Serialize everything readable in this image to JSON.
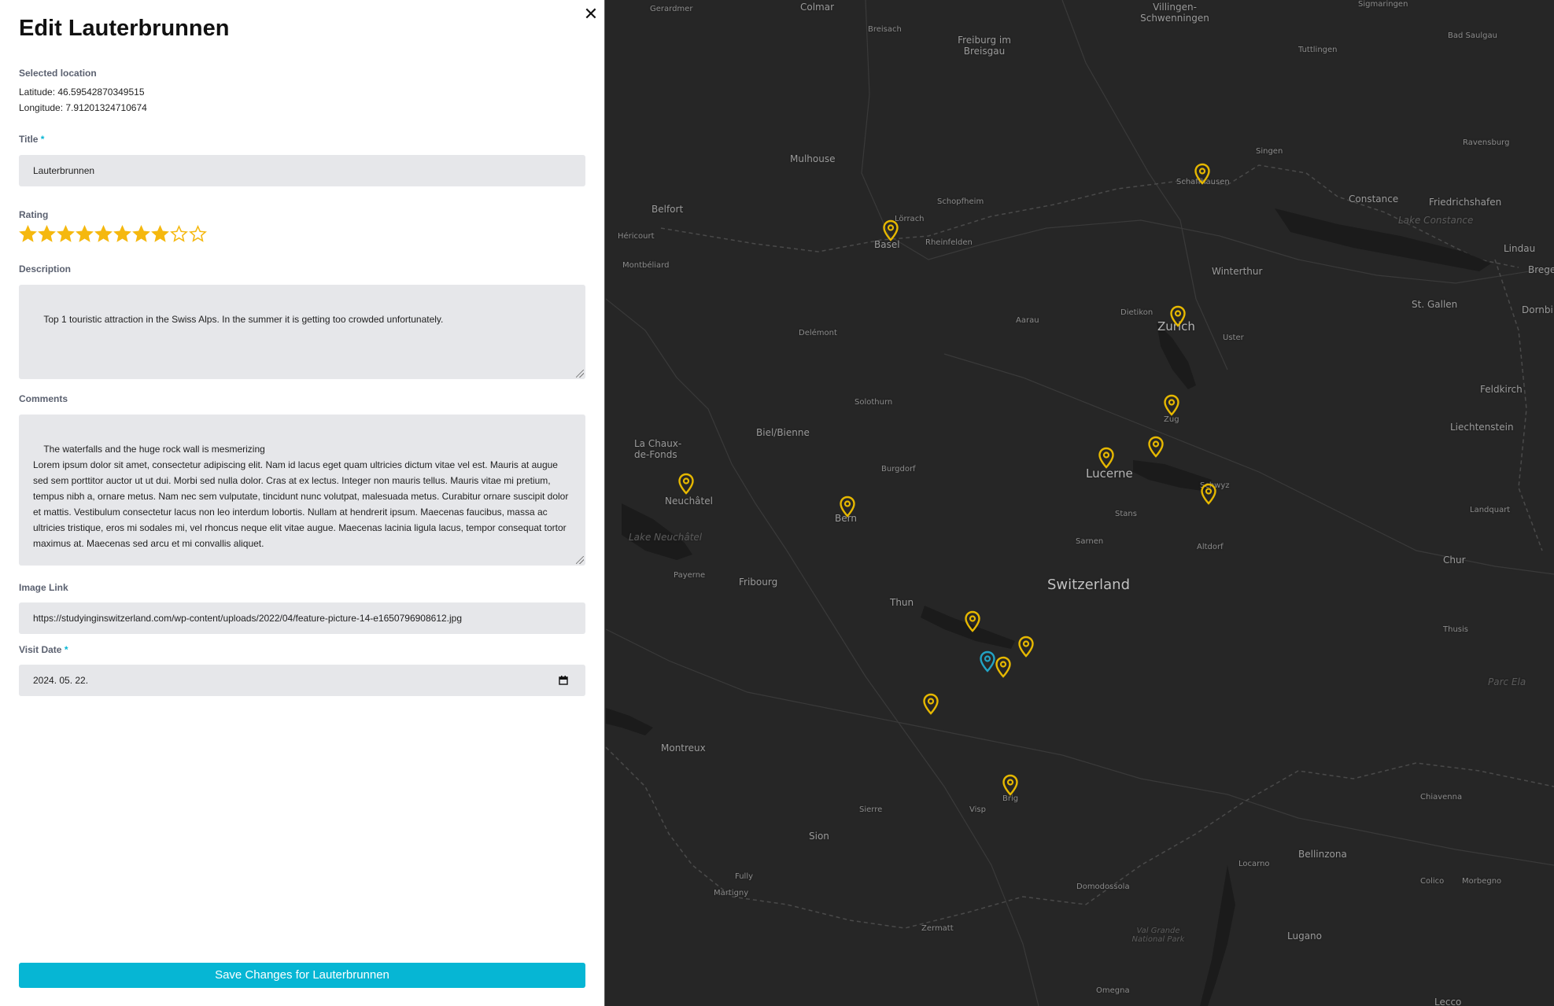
{
  "form": {
    "heading": "Edit Lauterbrunnen",
    "selected_location_label": "Selected location",
    "latitude_text": "Latitude: 46.59542870349515",
    "longitude_text": "Longitude: 7.91201324710674",
    "title_label": "Title",
    "required_mark": "*",
    "title_value": "Lauterbrunnen",
    "rating_label": "Rating",
    "rating_value": 8,
    "rating_max": 10,
    "description_label": "Description",
    "description_value": "Top 1 touristic attraction in the Swiss Alps. In the summer it is getting too crowded unfortunately.",
    "comments_label": "Comments",
    "comments_value": "The waterfalls and the huge rock wall is mesmerizing\nLorem ipsum dolor sit amet, consectetur adipiscing elit. Nam id lacus eget quam ultricies dictum vitae vel est. Mauris at augue sed sem porttitor auctor ut ut dui. Morbi sed nulla dolor. Cras at ex lectus. Integer non mauris tellus. Mauris vitae mi pretium, tempus nibh a, ornare metus. Nam nec sem vulputate, tincidunt nunc volutpat, malesuada metus. Curabitur ornare suscipit dolor et mattis. Vestibulum consectetur lacus non leo interdum lobortis. Nullam at hendrerit ipsum. Maecenas faucibus, massa ac ultricies tristique, eros mi sodales mi, vel rhoncus neque elit vitae augue. Maecenas lacinia ligula lacus, tempor consequat tortor maximus at. Maecenas sed arcu et mi convallis aliquet.",
    "image_link_label": "Image Link",
    "image_link_value": "https://studyinginswitzerland.com/wp-content/uploads/2022/04/feature-picture-14-e1650796908612.jpg",
    "visit_date_label": "Visit Date",
    "visit_date_value": "2024. 05. 22.",
    "save_button_label": "Save Changes for Lauterbrunnen",
    "close_label": "✕"
  },
  "map": {
    "attribution_logo": "mapbox",
    "colors": {
      "background": "#262626",
      "marker": "#e6b800",
      "selected_marker": "#22a3c4",
      "accent": "#06b6d4"
    },
    "places": [
      "Gerardmer",
      "Colmar",
      "Villingen-Schwenningen",
      "Sigmaringen",
      "Bad Saulgau",
      "Breisach",
      "Freiburg im Breisgau",
      "Tuttlingen",
      "Singen",
      "Ravensburg",
      "Mulhouse",
      "Schopfheim",
      "Constance",
      "Friedrichshafen",
      "Lake Constance",
      "Belfort",
      "Lörrach",
      "Schaffhausen",
      "Héricourt",
      "Basel",
      "Rheinfelden",
      "Lindau",
      "Bregenz",
      "Montbéliard",
      "Winterthur",
      "Dietikon",
      "St. Gallen",
      "Dornbirn",
      "Delémont",
      "Aarau",
      "Zurich",
      "Uster",
      "Feldkirch",
      "Solothurn",
      "Zug",
      "Biel/Bienne",
      "La Chaux-de-Fonds",
      "Burgdorf",
      "Liechtenstein",
      "Lucerne",
      "Schwyz",
      "Neuchâtel",
      "Bern",
      "Stans",
      "Landquart",
      "Lake Neuchâtel",
      "Sarnen",
      "Altdorf",
      "Payerne",
      "Fribourg",
      "Switzerland",
      "Chur",
      "Thun",
      "Thusis",
      "Parc Ela",
      "Montreux",
      "Chiavenna",
      "Sierre",
      "Visp",
      "Brig",
      "Sion",
      "Bellinzona",
      "Locarno",
      "Fully",
      "Domodossola",
      "Colico",
      "Morbegno",
      "Martigny",
      "Zermatt",
      "Val Grande National Park",
      "Lugano",
      "Omegna",
      "Lecco"
    ]
  }
}
